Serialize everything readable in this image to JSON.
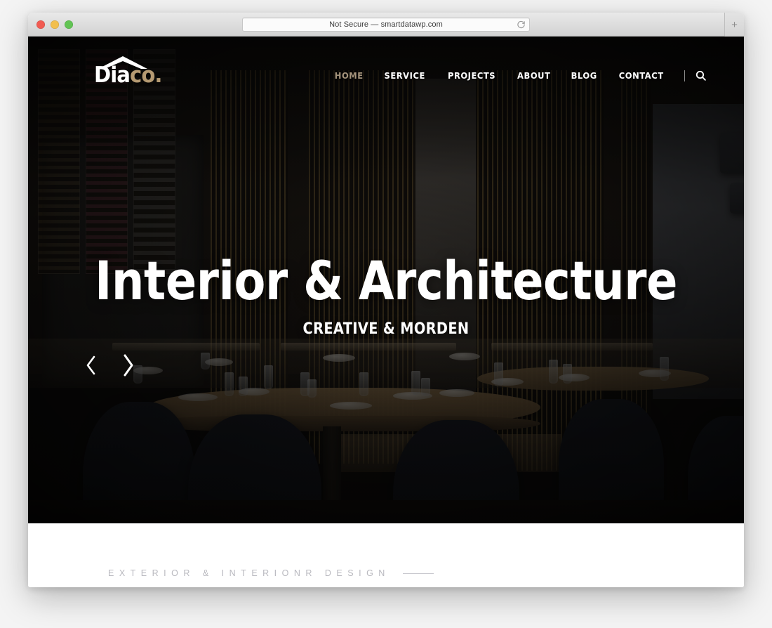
{
  "browser": {
    "url_label": "Not Secure — smartdatawp.com",
    "reload_icon": "reload-icon",
    "new_tab_label": "+",
    "traffic_lights": [
      {
        "name": "close",
        "color": "#f15b52"
      },
      {
        "name": "minimize",
        "color": "#f2bf4f"
      },
      {
        "name": "maximize",
        "color": "#62c454"
      }
    ]
  },
  "site": {
    "logo": {
      "primary": "Dia",
      "accent": "co.",
      "roof_icon": "house-roof-icon"
    },
    "nav": [
      {
        "label": "HOME",
        "active": true
      },
      {
        "label": "SERVICE",
        "active": false
      },
      {
        "label": "PROJECTS",
        "active": false
      },
      {
        "label": "ABOUT",
        "active": false
      },
      {
        "label": "BLOG",
        "active": false
      },
      {
        "label": "CONTACT",
        "active": false
      }
    ],
    "search_icon": "search-icon",
    "hero": {
      "title": "Interior & Architecture",
      "subtitle": "CREATIVE & MORDEN",
      "prev_icon": "chevron-left-icon",
      "next_icon": "chevron-right-icon"
    },
    "section": {
      "eyebrow": "EXTERIOR & INTERIONR DESIGN"
    }
  },
  "colors": {
    "accent": "#b59a72",
    "nav_active": "#a5947c",
    "hero_text": "#ffffff",
    "eyebrow": "#b9b9bf",
    "page_bg": "#ffffff"
  }
}
